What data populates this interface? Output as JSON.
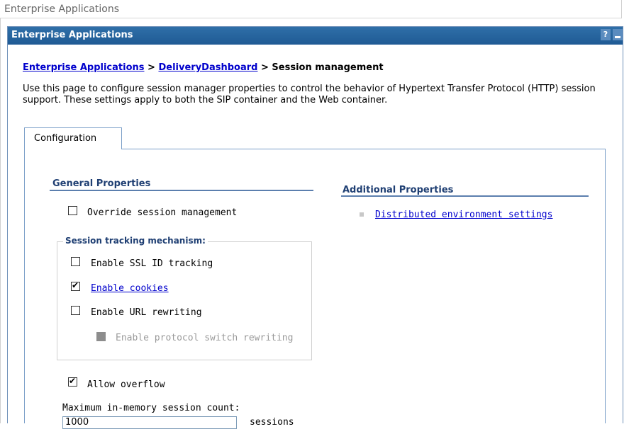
{
  "window_title": "Enterprise Applications",
  "panel": {
    "title": "Enterprise Applications",
    "help_label": "?",
    "minimize_label": "_"
  },
  "breadcrumb": {
    "crumb1": "Enterprise Applications",
    "sep1": ">",
    "crumb2": "DeliveryDashboard",
    "sep2": ">",
    "current": "Session management"
  },
  "description": "Use this page to configure session manager properties to control the behavior of Hypertext Transfer Protocol (HTTP) session support. These settings apply to both the SIP container and the Web container.",
  "tabs": [
    {
      "label": "Configuration"
    }
  ],
  "general_properties": {
    "heading": "General Properties",
    "override": {
      "label": "Override session management",
      "checked": false
    },
    "tracking": {
      "legend": "Session tracking mechanism:",
      "ssl": {
        "label": "Enable SSL ID tracking",
        "checked": false
      },
      "cookies": {
        "label": "Enable cookies",
        "checked": true
      },
      "url_rewriting": {
        "label": "Enable URL rewriting",
        "checked": false
      },
      "protocol_switch": {
        "label": "Enable protocol switch rewriting",
        "checked": false,
        "disabled": true
      }
    },
    "allow_overflow": {
      "label": "Allow overflow",
      "checked": true
    },
    "max_sessions": {
      "label": "Maximum in-memory session count:",
      "value": "1000",
      "unit_partial": "sessions"
    }
  },
  "additional_properties": {
    "heading": "Additional Properties",
    "links": [
      {
        "label": "Distributed environment settings"
      }
    ]
  },
  "colors": {
    "header_blue": "#1f5a94",
    "link": "#0000cc",
    "section_heading": "#1f3f73",
    "rule": "#5b7fae"
  }
}
